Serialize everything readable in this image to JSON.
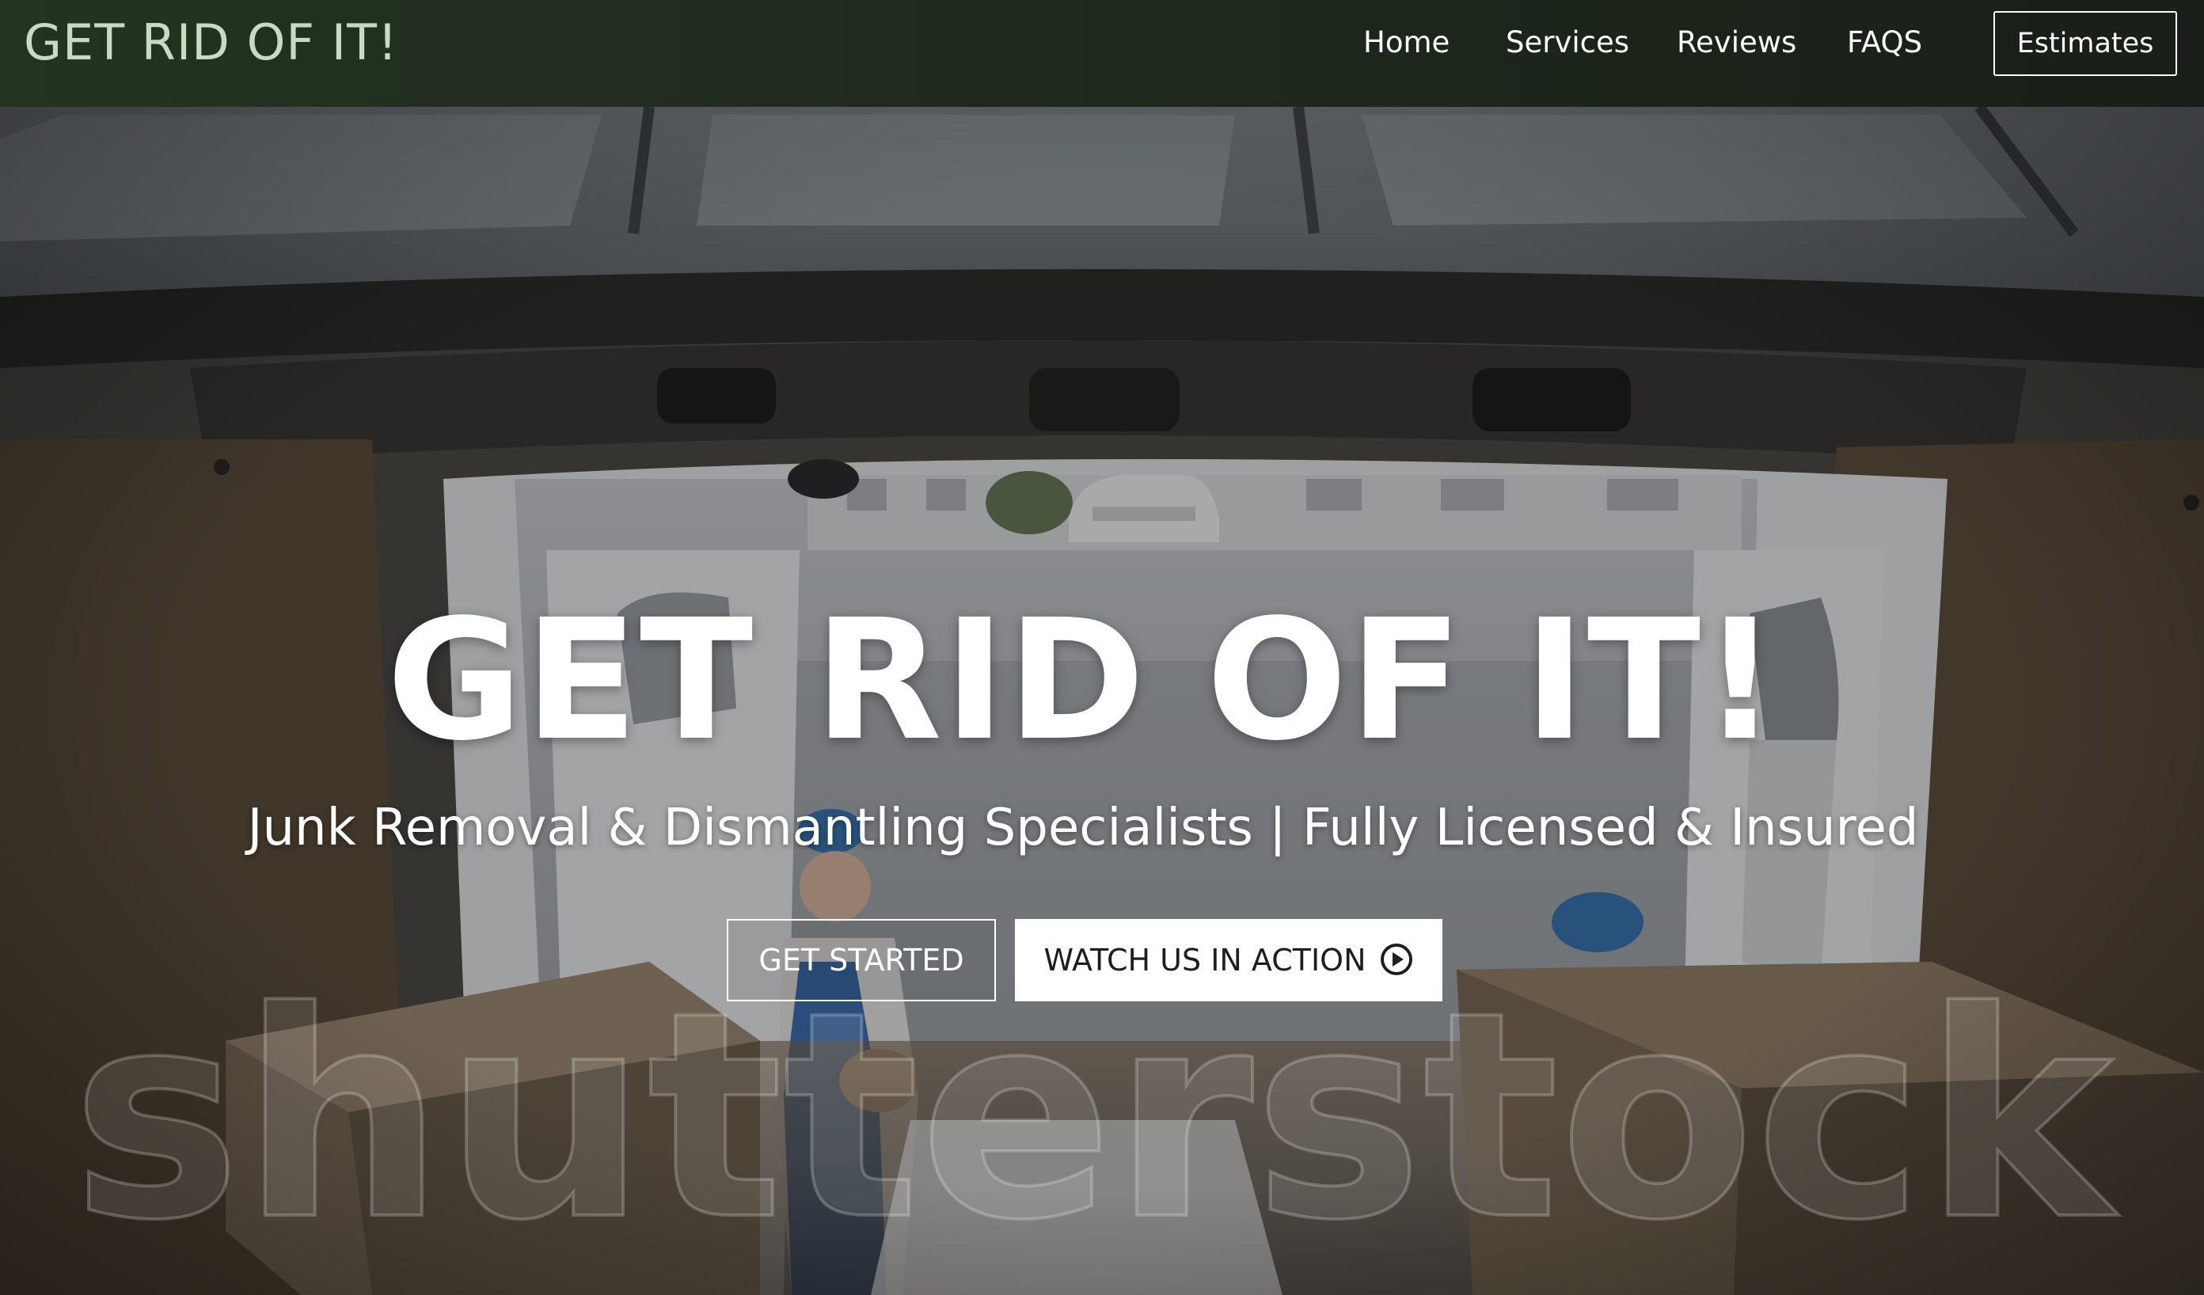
{
  "navbar": {
    "brand": "GET RID OF IT!",
    "links": [
      "Home",
      "Services",
      "Reviews",
      "FAQS"
    ],
    "estimates_label": "Estimates"
  },
  "hero": {
    "title": "GET RID OF IT!",
    "subtitle": "Junk Removal & Dismantling Specialists | Fully Licensed & Insured",
    "get_started_label": "GET STARTED",
    "watch_label": "WATCH US IN ACTION",
    "watch_icon": "play-circle-icon",
    "watermark": "shutterstock"
  },
  "colors": {
    "navbar_bg": "#1f2a1d",
    "brand_text": "#c9d9c2",
    "text_white": "#ffffff"
  }
}
